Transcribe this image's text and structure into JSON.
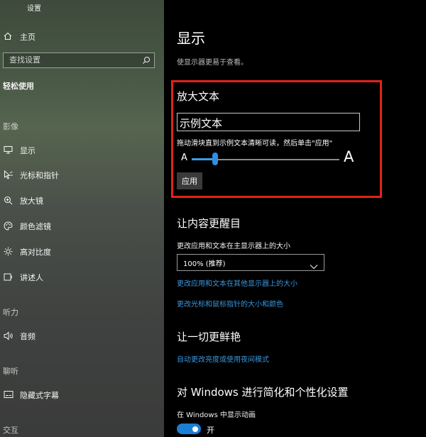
{
  "window": {
    "title": "设置"
  },
  "sidebar": {
    "home_label": "主页",
    "search_placeholder": "查找设置",
    "category_title": "轻松使用",
    "groups": {
      "vision": "影像",
      "hearing": "听力",
      "interaction": "聊听",
      "last": "交互"
    },
    "items": [
      {
        "label": "显示",
        "icon": "monitor-icon"
      },
      {
        "label": "光标和指针",
        "icon": "pointer-icon"
      },
      {
        "label": "放大镜",
        "icon": "magnifier-icon"
      },
      {
        "label": "颜色滤镜",
        "icon": "palette-icon"
      },
      {
        "label": "高对比度",
        "icon": "sun-icon"
      },
      {
        "label": "讲述人",
        "icon": "narrator-icon"
      },
      {
        "label": "音频",
        "icon": "speaker-icon"
      },
      {
        "label": "隐藏式字幕",
        "icon": "captions-icon"
      }
    ]
  },
  "main": {
    "title": "显示",
    "subtitle": "使显示器更易于查看。",
    "bigger_text": {
      "title": "放大文本",
      "sample_text": "示例文本",
      "hint": "拖动滑块直到示例文本清晰可读，然后单击\"应用\"",
      "small_a": "A",
      "big_a": "A",
      "slider_value_fraction": 0.16,
      "apply_label": "应用"
    },
    "make_everything_bigger": {
      "title": "让内容更醒目",
      "scale_label": "更改应用和文本在主显示器上的大小",
      "scale_value": "100% (推荐)",
      "link_other_displays": "更改应用和文本在其他显示器上的大小",
      "link_pointer": "更改光标和鼠标指针的大小和颜色"
    },
    "brighter": {
      "title": "让一切更鲜艳",
      "link_night": "自动更改亮度或使用夜间模式"
    },
    "simplify": {
      "title": "对 Windows 进行简化和个性化设置",
      "animations_label": "在 Windows 中显示动画",
      "animations_state": "开"
    }
  },
  "colors": {
    "accent": "#2f8fe0",
    "link": "#3a96dd",
    "highlight_border": "#e2231a"
  }
}
